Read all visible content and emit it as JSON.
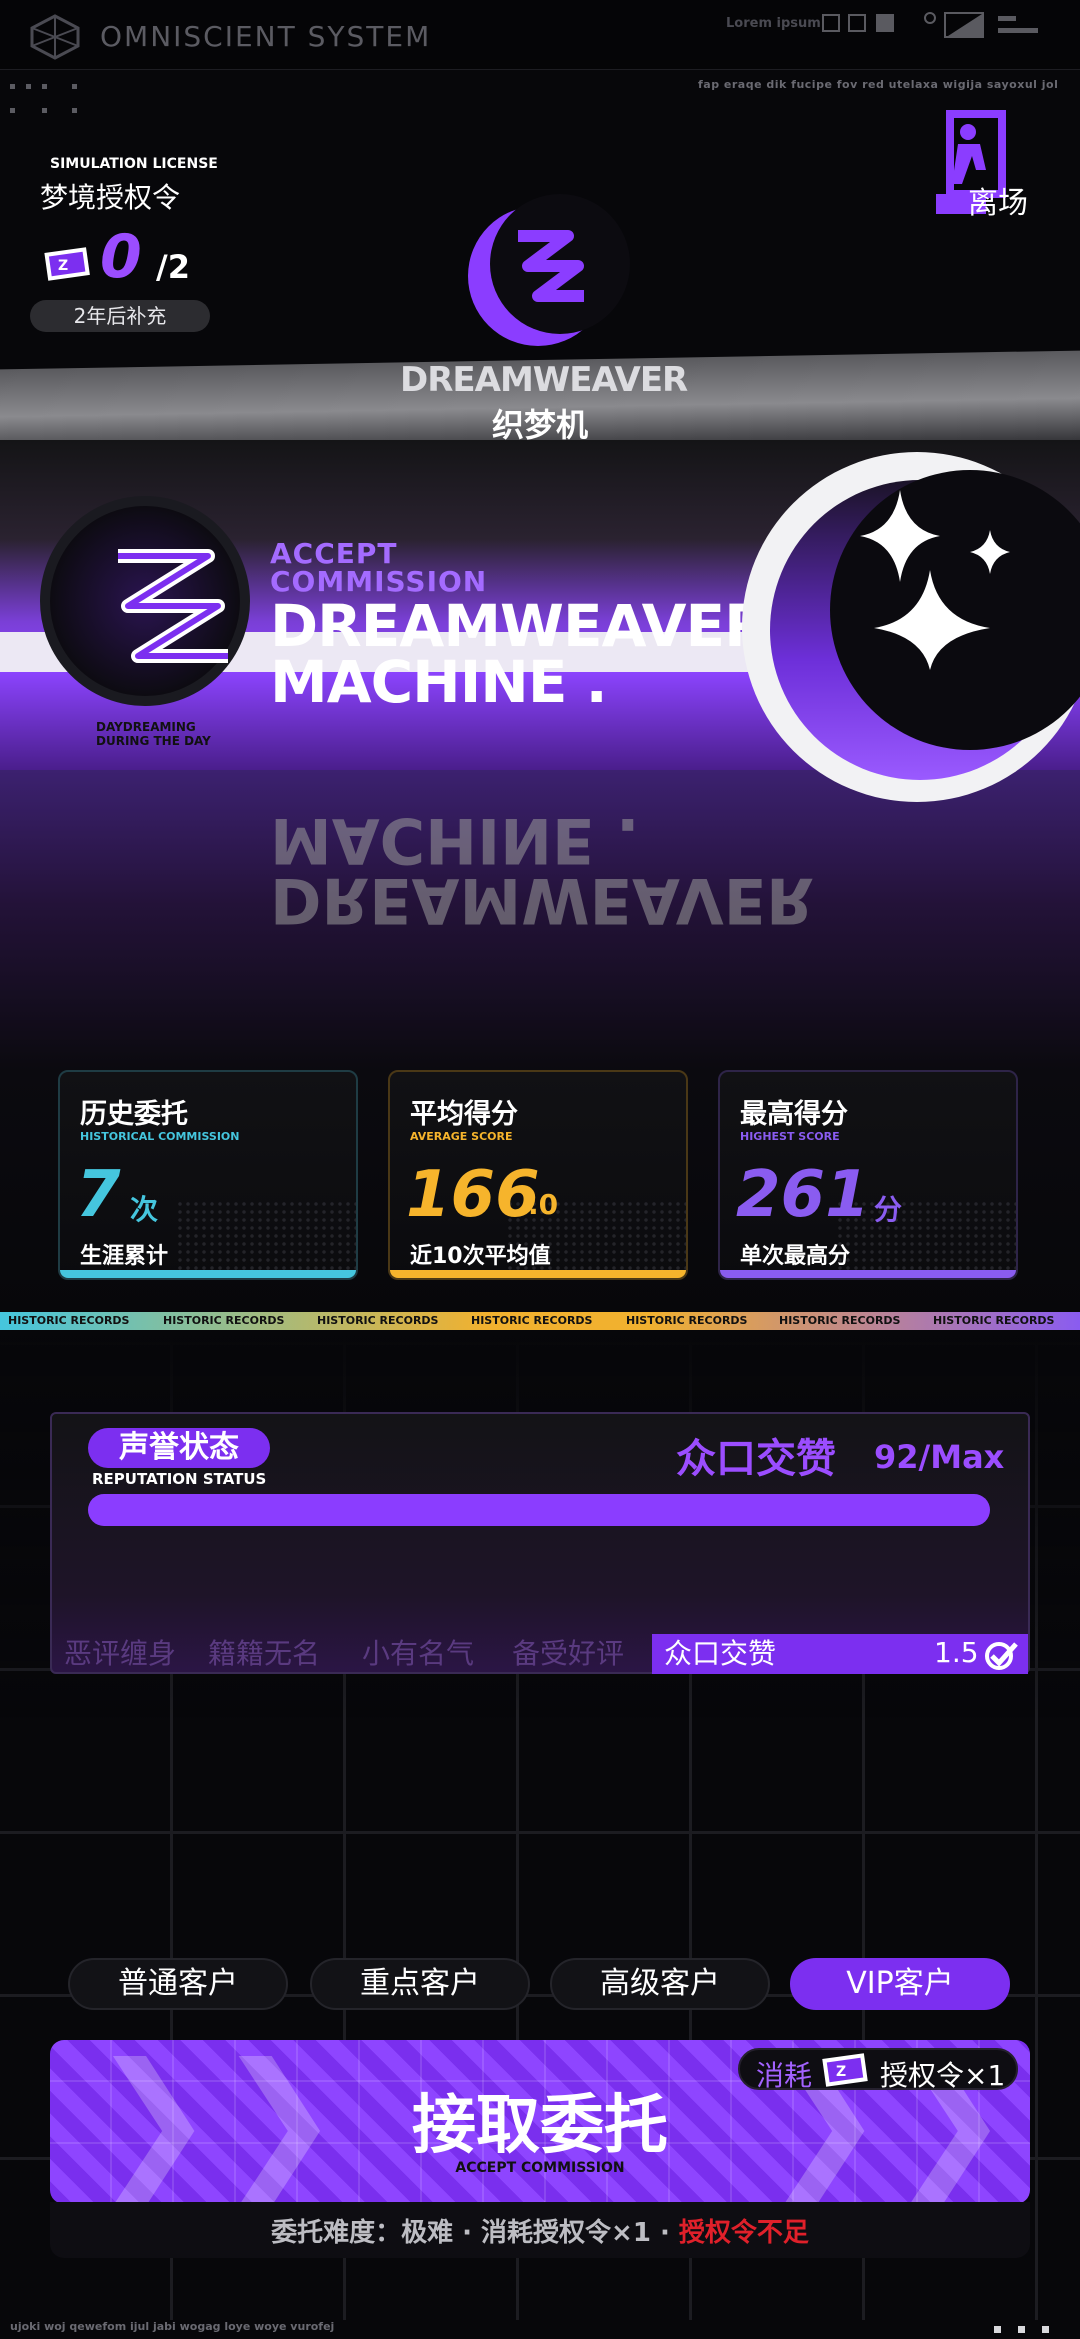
{
  "system": {
    "title": "OMNISCIENT SYSTEM",
    "top_lorem": "Lorem ipsum",
    "gibberish": "fap eraqe dik fucipe fov red utelaxa wigija sayoxul jol"
  },
  "license": {
    "label_en": "SIMULATION LICENSE",
    "label_cn": "梦境授权令",
    "count": "0",
    "total": "/2",
    "refill": "2年后补充"
  },
  "exit": {
    "label": "离场",
    "icon": "exit-door-icon"
  },
  "brand": {
    "name": "DREAMWEAVER",
    "name_cn": "织梦机",
    "icon": "sleep-z-moon-icon"
  },
  "hero": {
    "accept_small_1": "ACCEPT",
    "accept_small_2": "COMMISSION",
    "title_1": "DREAMWEAVER",
    "title_2": "MACHINE .",
    "emblem_tag_1": "DAYDREAMING",
    "emblem_tag_2": "DURING THE DAY"
  },
  "stats": [
    {
      "title": "历史委托",
      "sub": "HISTORICAL COMMISSION",
      "value": "7",
      "unit": "次",
      "foot": "生涯累计",
      "color": "#45c6de"
    },
    {
      "title": "平均得分",
      "sub": "AVERAGE SCORE",
      "value": "166",
      "decimal": ".0",
      "foot": "近10次平均值",
      "color": "#f6b42c"
    },
    {
      "title": "最高得分",
      "sub": "HIGHEST SCORE",
      "value": "261",
      "unit": "分",
      "foot": "单次最高分",
      "color": "#8a5cf0"
    }
  ],
  "historic_records": [
    "HISTORIC RECORDS",
    "HISTORIC RECORDS",
    "HISTORIC RECORDS",
    "HISTORIC RECORDS",
    "HISTORIC RECORDS",
    "HISTORIC RECORDS",
    "HISTORIC RECORDS"
  ],
  "reputation": {
    "label_cn": "声誉状态",
    "label_en": "REPUTATION STATUS",
    "status": "众口交赞",
    "score": "92/Max",
    "progress": 1.0,
    "segments": [
      "恶评缠身",
      "籍籍无名",
      "小有名气",
      "备受好评",
      "众口交赞"
    ],
    "multiplier": "1.5"
  },
  "tiers": [
    "普通客户",
    "重点客户",
    "高级客户",
    "VIP客户"
  ],
  "accept": {
    "main": "接取委托",
    "en": "ACCEPT COMMISSION",
    "cost_label": "消耗",
    "cost_value": "授权令×1"
  },
  "difficulty": {
    "prefix": "委托难度：极难 · 消耗授权令×1 · ",
    "warning": "授权令不足"
  },
  "footer": "ujoki woj qewefom ijul jabi wogag loye woye vurofej",
  "colors": {
    "accent": "#8b3dff",
    "cyan": "#45c6de",
    "gold": "#f6b42c",
    "warn": "#e0202a"
  }
}
